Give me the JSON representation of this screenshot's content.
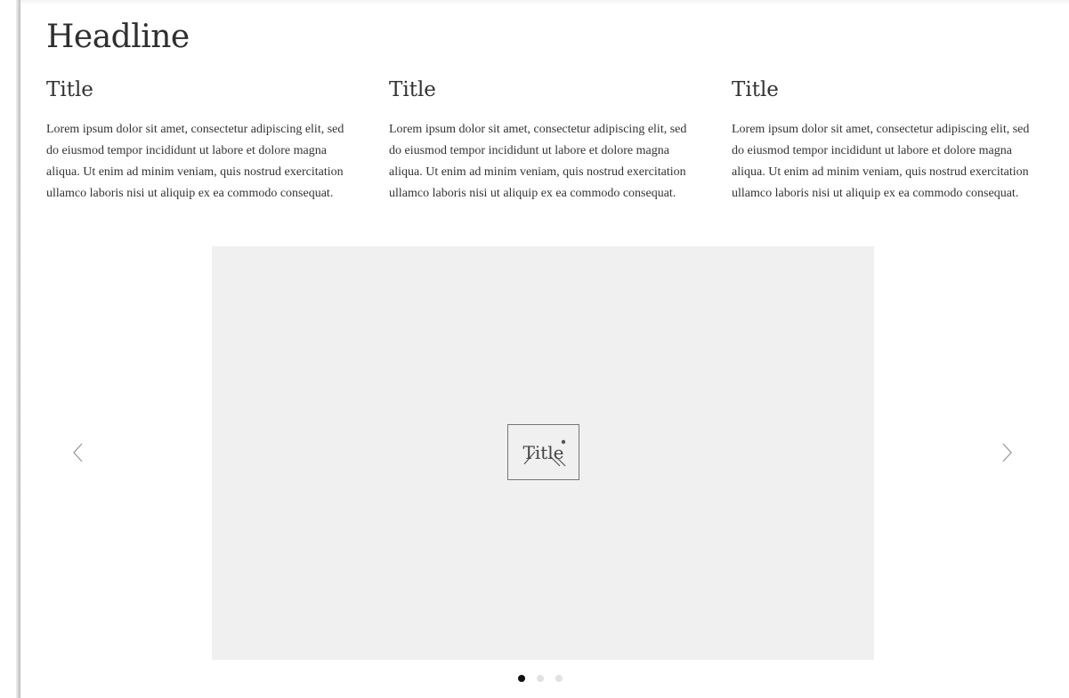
{
  "header": {
    "headline": "Headline"
  },
  "columns": [
    {
      "title": "Title",
      "text": "Lorem ipsum dolor sit amet, consectetur adipiscing elit, sed do eiusmod tempor incididunt ut labore et dolore magna aliqua. Ut enim ad minim veniam, quis nostrud exercitation ullamco laboris nisi ut aliquip ex ea commodo consequat."
    },
    {
      "title": "Title",
      "text": "Lorem ipsum dolor sit amet, consectetur adipiscing elit, sed do eiusmod tempor incididunt ut labore et dolore magna aliqua. Ut enim ad minim veniam, quis nostrud exercitation ullamco laboris nisi ut aliquip ex ea commodo consequat."
    },
    {
      "title": "Title",
      "text": "Lorem ipsum dolor sit amet, consectetur adipiscing elit, sed do eiusmod tempor incididunt ut labore et dolore magna aliqua. Ut enim ad minim veniam, quis nostrud exercitation ullamco laboris nisi ut aliquip ex ea commodo consequat."
    }
  ],
  "carousel": {
    "slide_title": "Title",
    "prev_icon": "chevron-left-icon",
    "next_icon": "chevron-right-icon",
    "slide_count": 3,
    "active_index": 0
  },
  "colors": {
    "slide_background": "#f0f0f0",
    "active_dot": "#111111",
    "inactive_dot": "#e2e2e2",
    "text": "#333333"
  }
}
